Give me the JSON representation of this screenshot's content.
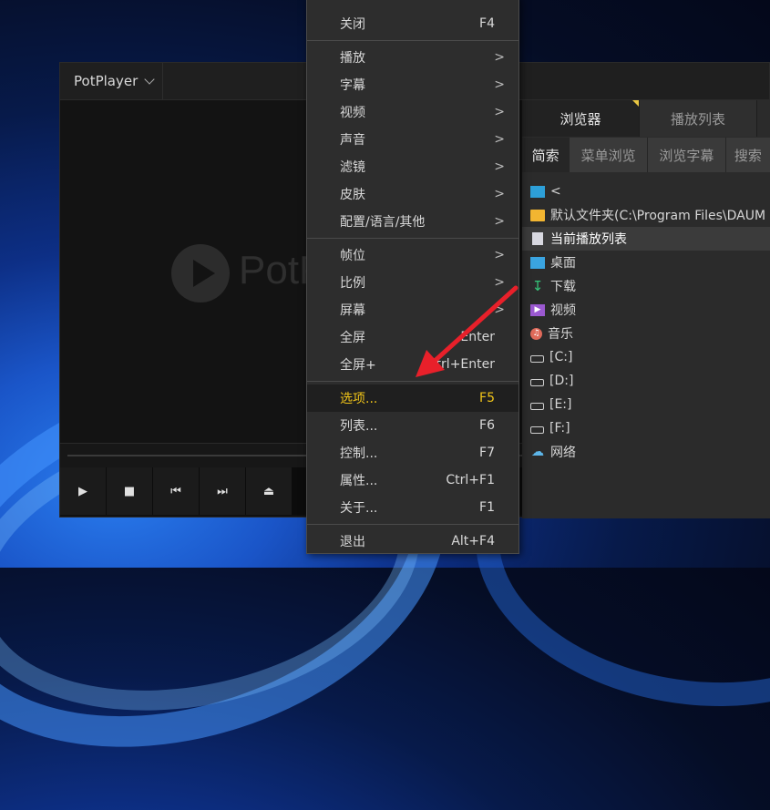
{
  "player": {
    "app_menu_label": "PotPlayer",
    "logo_text": "PotPlayer",
    "controls": [
      "play",
      "stop",
      "previous",
      "next",
      "eject"
    ]
  },
  "panel": {
    "tabs": [
      "浏览器",
      "播放列表"
    ],
    "subtabs": [
      "简索",
      "菜单浏览",
      "浏览字幕",
      "搜索"
    ],
    "rows": [
      {
        "icon": "up-icon",
        "text": "<"
      },
      {
        "icon": "folder-icon",
        "text": "默认文件夹(C:\\Program Files\\DAUM"
      },
      {
        "icon": "playlist-icon",
        "text": "当前播放列表"
      },
      {
        "icon": "desktop-icon",
        "text": "桌面"
      },
      {
        "icon": "download-icon",
        "text": "下载"
      },
      {
        "icon": "video-icon",
        "text": "视频"
      },
      {
        "icon": "music-icon",
        "text": "音乐"
      },
      {
        "icon": "drive-icon",
        "text": "[C:]"
      },
      {
        "icon": "drive-icon",
        "text": "[D:]"
      },
      {
        "icon": "drive-icon",
        "text": "[E:]"
      },
      {
        "icon": "drive-icon",
        "text": "[F:]"
      },
      {
        "icon": "network-icon",
        "text": "网络"
      }
    ]
  },
  "menu": {
    "items": [
      {
        "label": "关闭",
        "key": "F4"
      },
      {
        "label": "播放",
        "sub": ">"
      },
      {
        "label": "字幕",
        "sub": ">"
      },
      {
        "label": "视频",
        "sub": ">"
      },
      {
        "label": "声音",
        "sub": ">"
      },
      {
        "label": "滤镜",
        "sub": ">"
      },
      {
        "label": "皮肤",
        "sub": ">"
      },
      {
        "label": "配置/语言/其他",
        "sub": ">"
      },
      {
        "label": "帧位",
        "sub": ">"
      },
      {
        "label": "比例",
        "sub": ">"
      },
      {
        "label": "屏幕",
        "sub": ">"
      },
      {
        "label": "全屏",
        "key": "Enter"
      },
      {
        "label": "全屏+",
        "key": "Ctrl+Enter"
      },
      {
        "label": "选项...",
        "key": "F5"
      },
      {
        "label": "列表...",
        "key": "F6"
      },
      {
        "label": "控制...",
        "key": "F7"
      },
      {
        "label": "属性...",
        "key": "Ctrl+F1"
      },
      {
        "label": "关于...",
        "key": "F1"
      },
      {
        "label": "退出",
        "key": "Alt+F4"
      }
    ]
  },
  "colors": {
    "highlight": "#f0c419",
    "arrow": "#e8202a",
    "accent": "#e8c642"
  }
}
